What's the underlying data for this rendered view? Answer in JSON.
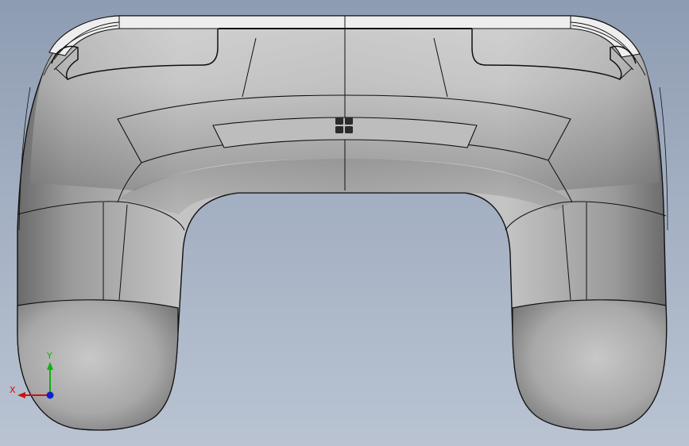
{
  "viewport": {
    "background_top": "#8e9cb2",
    "background_bottom": "#b9c3d2"
  },
  "model": {
    "subject": "gamepad-controller-shell",
    "body_color": "#b0b0b0",
    "edge_color": "#111111",
    "button_color": "#2a2a2a"
  },
  "triad": {
    "x_label": "X",
    "y_label": "Y",
    "x_color": "#d01010",
    "y_color": "#10b010",
    "z_color": "#1020d0"
  }
}
